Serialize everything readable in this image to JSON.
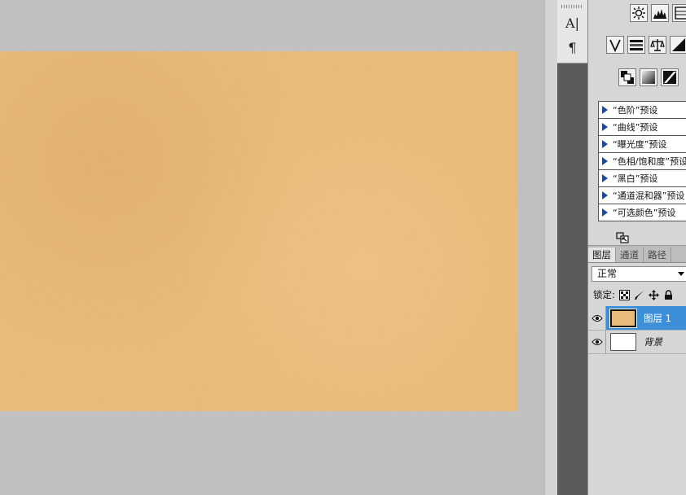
{
  "strip_tools": {
    "character": "A|",
    "paragraph": "¶"
  },
  "adjustment_presets": [
    "“色阶”预设",
    "“曲线”预设",
    "“曝光度”预设",
    "“色相/饱和度”预设",
    "“黑白”预设",
    "“通道混和器”预设",
    "“可选颜色”预设"
  ],
  "layers_panel": {
    "tabs": [
      "图层",
      "通道",
      "路径"
    ],
    "blend_mode": "正常",
    "lock_label": "锁定:",
    "layers": [
      {
        "name": "图层 1",
        "selected": true,
        "thumb_color": "#e9bb78"
      },
      {
        "name": "背景",
        "selected": false,
        "thumb_color": "#ffffff"
      }
    ]
  },
  "colors": {
    "canvas_fill": "#e9bb78",
    "workspace_bg": "#c0c0c0",
    "selection_blue": "#3c8fd8",
    "tool_strip": "#5b5b5b"
  }
}
